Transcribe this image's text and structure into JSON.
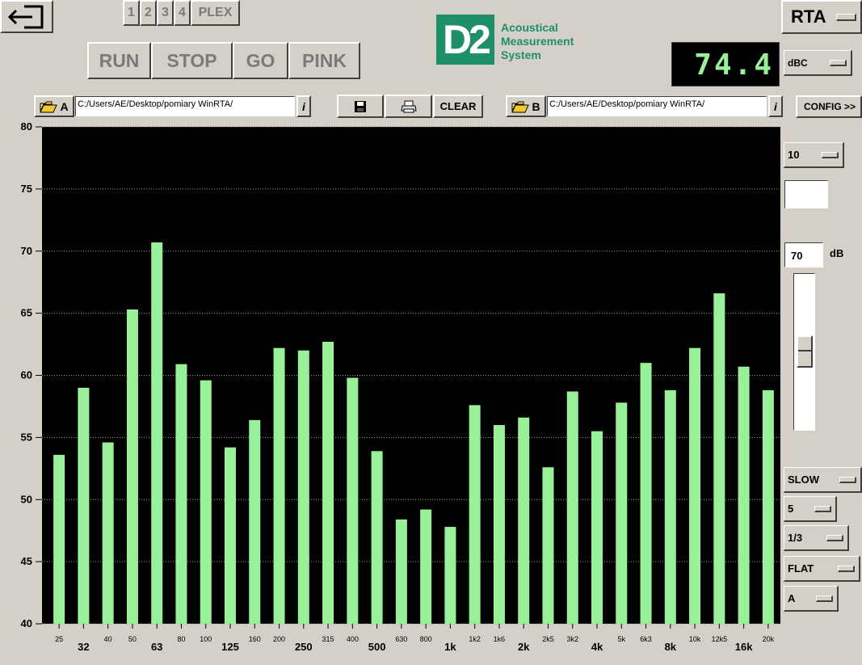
{
  "toolbar": {
    "back_label": "",
    "channels": [
      "1",
      "2",
      "3",
      "4",
      "PLEX"
    ],
    "run_label": "RUN",
    "stop_label": "STOP",
    "go_label": "GO",
    "pink_label": "PINK",
    "save_icon": "floppy-disk-icon",
    "print_icon": "printer-icon",
    "clear_label": "CLEAR",
    "config_label": "CONFIG >>"
  },
  "logo": {
    "mark": "D2",
    "line1": "Acoustical",
    "line2": "Measurement",
    "line3": "System"
  },
  "mode_label": "RTA",
  "level_readout": "74.4",
  "weighting_label": "dBC",
  "file_a": {
    "label": "A",
    "path": "C:/Users/AE/Desktop/pomiary WinRTA/",
    "info": "i"
  },
  "file_b": {
    "label": "B",
    "path": "C:/Users/AE/Desktop/pomiary WinRTA/",
    "info": "i"
  },
  "right_panel": {
    "range_label": "10",
    "ref_level_value": "70",
    "ref_level_unit": "dB",
    "speed_label": "SLOW",
    "avg_label": "5",
    "band_label": "1/3",
    "curve_label": "FLAT",
    "channel_label": "A"
  },
  "colors": {
    "bar": "#98f098",
    "plot_bg": "#000000",
    "readout_text": "#98f098",
    "panel": "#d4d0c8"
  },
  "chart_data": {
    "type": "bar",
    "ylim": [
      40,
      80
    ],
    "yticks": [
      40,
      45,
      50,
      55,
      60,
      65,
      70,
      75,
      80
    ],
    "grid": true,
    "categories": [
      "25",
      "32",
      "40",
      "50",
      "63",
      "80",
      "100",
      "125",
      "160",
      "200",
      "250",
      "315",
      "400",
      "500",
      "630",
      "800",
      "1k",
      "1k2",
      "1k6",
      "2k",
      "2k5",
      "3k2",
      "4k",
      "5k",
      "6k3",
      "8k",
      "10k",
      "12k5",
      "16k",
      "20k"
    ],
    "major": [
      false,
      true,
      false,
      false,
      true,
      false,
      false,
      true,
      false,
      false,
      true,
      false,
      false,
      true,
      false,
      false,
      true,
      false,
      false,
      true,
      false,
      false,
      true,
      false,
      false,
      true,
      false,
      false,
      true,
      false
    ],
    "values": [
      53.6,
      59.0,
      54.6,
      65.3,
      70.7,
      60.9,
      59.6,
      54.2,
      56.4,
      62.2,
      62.0,
      62.7,
      59.8,
      53.9,
      48.4,
      49.2,
      47.8,
      57.6,
      56.0,
      56.6,
      52.6,
      58.7,
      55.5,
      57.8,
      61.0,
      58.8,
      62.2,
      66.6,
      60.7,
      58.8
    ]
  }
}
